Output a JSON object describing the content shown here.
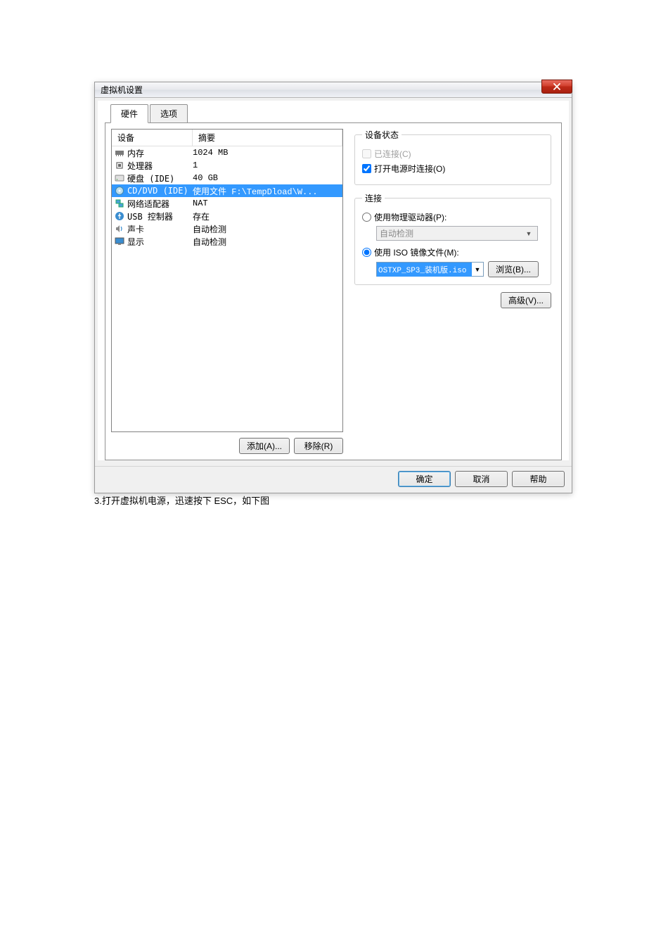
{
  "window": {
    "title": "虚拟机设置",
    "close_icon": "x"
  },
  "tabs": {
    "hardware": "硬件",
    "options": "选项"
  },
  "device_list": {
    "header_device": "设备",
    "header_summary": "摘要",
    "rows": [
      {
        "icon": "memory",
        "name": "内存",
        "summary": "1024 MB"
      },
      {
        "icon": "cpu",
        "name": "处理器",
        "summary": "1"
      },
      {
        "icon": "hdd",
        "name": "硬盘 (IDE)",
        "summary": "40 GB"
      },
      {
        "icon": "cd",
        "name": "CD/DVD (IDE)",
        "summary": "使用文件 F:\\TempDload\\W..."
      },
      {
        "icon": "net",
        "name": "网络适配器",
        "summary": "NAT"
      },
      {
        "icon": "usb",
        "name": "USB 控制器",
        "summary": "存在"
      },
      {
        "icon": "sound",
        "name": "声卡",
        "summary": "自动检测"
      },
      {
        "icon": "display",
        "name": "显示",
        "summary": "自动检测"
      }
    ]
  },
  "buttons": {
    "add": "添加(A)...",
    "remove": "移除(R)",
    "browse": "浏览(B)...",
    "advanced": "高级(V)...",
    "ok": "确定",
    "cancel": "取消",
    "help": "帮助"
  },
  "status_group": {
    "legend": "设备状态",
    "connected": "已连接(C)",
    "connect_on_power": "打开电源时连接(O)"
  },
  "connection_group": {
    "legend": "连接",
    "use_physical": "使用物理驱动器(P):",
    "auto_detect": "自动检测",
    "use_iso": "使用 ISO 镜像文件(M):",
    "iso_value": "OSTXP_SP3_装机版.iso"
  },
  "caption": "3.打开虚拟机电源，迅速按下 ESC，如下图"
}
